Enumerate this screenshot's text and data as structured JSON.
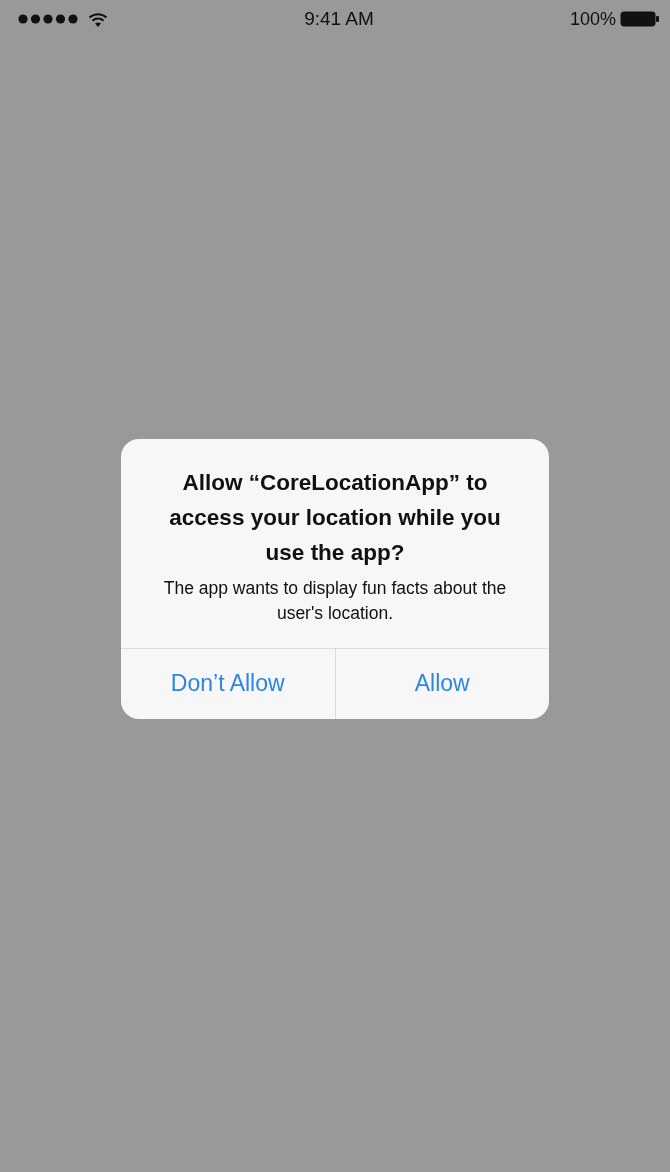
{
  "status_bar": {
    "time": "9:41 AM",
    "battery": "100%"
  },
  "alert": {
    "title": "Allow “CoreLocationApp” to access your location while you use the app?",
    "message": "The app wants to display fun facts about the user's location.",
    "buttons": [
      {
        "label": "Don’t Allow"
      },
      {
        "label": "Allow"
      }
    ]
  }
}
